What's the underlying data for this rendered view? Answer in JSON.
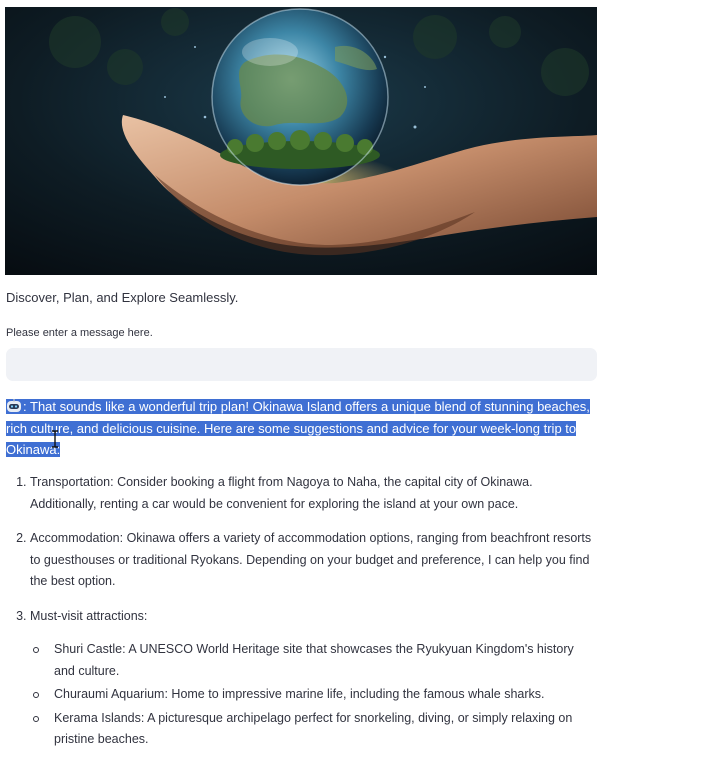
{
  "hero": {
    "image": "hands-holding-glass-globe"
  },
  "subtitle": "Discover, Plan, and Explore Seamlessly.",
  "chat": {
    "input_label": "Please enter a message here.",
    "input_value": "",
    "input_placeholder": ""
  },
  "response": {
    "avatar_icon": "robot-icon",
    "prefix": ": ",
    "intro": "That sounds like a wonderful trip plan! Okinawa Island offers a unique blend of stunning beaches, rich culture, and delicious cuisine. Here are some suggestions and advice for your week-long trip to Okinawa:",
    "highlight_color": "#3f6fd3",
    "items": [
      "Transportation: Consider booking a flight from Nagoya to Naha, the capital city of Okinawa. Additionally, renting a car would be convenient for exploring the island at your own pace.",
      "Accommodation: Okinawa offers a variety of accommodation options, ranging from beachfront resorts to guesthouses or traditional Ryokans. Depending on your budget and preference, I can help you find the best option.",
      "Must-visit attractions:"
    ],
    "attractions": [
      "Shuri Castle: A UNESCO World Heritage site that showcases the Ryukyuan Kingdom's history and culture.",
      "Churaumi Aquarium: Home to impressive marine life, including the famous whale sharks.",
      "Kerama Islands: A picturesque archipelago perfect for snorkeling, diving, or simply relaxing on pristine beaches."
    ]
  }
}
